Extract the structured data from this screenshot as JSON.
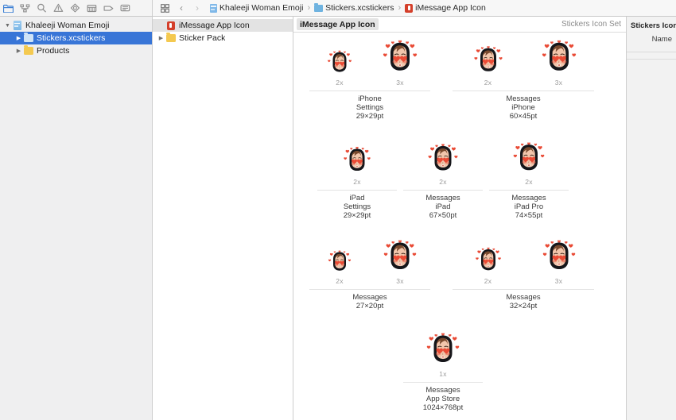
{
  "window": {
    "title": "Xcode"
  },
  "toolbar": {
    "left_icons": [
      {
        "name": "navigator-folder-icon",
        "glyph": "folder",
        "active": true
      },
      {
        "name": "source-control-icon",
        "glyph": "branch",
        "active": false
      },
      {
        "name": "search-icon",
        "glyph": "magnifier",
        "active": false
      },
      {
        "name": "issue-navigator-icon",
        "glyph": "warning-triangle",
        "active": false
      },
      {
        "name": "test-navigator-icon",
        "glyph": "diamond",
        "active": false
      },
      {
        "name": "debug-navigator-icon",
        "glyph": "gauge",
        "active": false
      },
      {
        "name": "breakpoint-navigator-icon",
        "glyph": "tag",
        "active": false
      },
      {
        "name": "report-navigator-icon",
        "glyph": "speech-bubble",
        "active": false
      }
    ],
    "grid_button": "grid-view-icon",
    "back_arrow": "‹",
    "forward_arrow": "›"
  },
  "breadcrumbs": {
    "separator": "›",
    "items": [
      {
        "label": "Khaleeji Woman Emoji",
        "icon": "project-icon"
      },
      {
        "label": "Stickers.xcstickers",
        "icon": "sticker-catalog-icon"
      },
      {
        "label": "iMessage App Icon",
        "icon": "app-icon-badge"
      }
    ]
  },
  "navigator": {
    "rows": [
      {
        "label": "Khaleeji Woman Emoji",
        "indent": 0,
        "twisty": "open",
        "icon": "project-icon",
        "selected": false
      },
      {
        "label": "Stickers.xcstickers",
        "indent": 1,
        "twisty": "none",
        "icon": "sticker-catalog-icon",
        "selected": true
      },
      {
        "label": "Products",
        "indent": 1,
        "twisty": "closed",
        "icon": "folder-icon",
        "selected": false
      }
    ]
  },
  "asset_list": {
    "rows": [
      {
        "label": "iMessage App Icon",
        "twisty": "none",
        "icon": "app-icon-badge",
        "selected": true
      },
      {
        "label": "Sticker Pack",
        "twisty": "closed",
        "icon": "folder-icon",
        "selected": false
      }
    ]
  },
  "editor": {
    "title": "iMessage App Icon",
    "subtitle": "Stickers Icon Set"
  },
  "inspector": {
    "title": "Stickers Icon",
    "name_label": "Name"
  },
  "icon_set": {
    "groups": [
      {
        "id": "iphone-settings",
        "caption": [
          "iPhone",
          "Settings",
          "29×29pt"
        ],
        "slots": [
          {
            "scale": "2x",
            "size": 34
          },
          {
            "scale": "3x",
            "size": 48
          }
        ]
      },
      {
        "id": "messages-iphone",
        "caption": [
          "Messages",
          "iPhone",
          "60×45pt"
        ],
        "slots": [
          {
            "scale": "2x",
            "size": 40
          },
          {
            "scale": "3x",
            "size": 48
          }
        ]
      },
      {
        "id": "ipad-settings",
        "caption": [
          "iPad",
          "Settings",
          "29×29pt"
        ],
        "slots": [
          {
            "scale": "2x",
            "size": 38
          }
        ]
      },
      {
        "id": "messages-ipad",
        "caption": [
          "Messages",
          "iPad",
          "67×50pt"
        ],
        "slots": [
          {
            "scale": "2x",
            "size": 42
          }
        ]
      },
      {
        "id": "messages-ipad-pro",
        "caption": [
          "Messages",
          "iPad Pro",
          "74×55pt"
        ],
        "slots": [
          {
            "scale": "2x",
            "size": 44
          }
        ]
      },
      {
        "id": "messages-27x20",
        "caption": [
          "Messages",
          "27×20pt"
        ],
        "slots": [
          {
            "scale": "2x",
            "size": 32
          },
          {
            "scale": "3x",
            "size": 46
          }
        ]
      },
      {
        "id": "messages-32x24",
        "caption": [
          "Messages",
          "32×24pt"
        ],
        "slots": [
          {
            "scale": "2x",
            "size": 36
          },
          {
            "scale": "3x",
            "size": 46
          }
        ]
      },
      {
        "id": "messages-app-store",
        "caption": [
          "Messages",
          "App Store",
          "1024×768pt"
        ],
        "slots": [
          {
            "scale": "1x",
            "size": 46
          }
        ]
      }
    ]
  },
  "colors": {
    "selection_blue": "#3875d7",
    "window_chrome": "#f2f2f2",
    "navigator_bg": "#efeff0",
    "editor_bg": "#ffffff",
    "hijab_black": "#16161a",
    "skin": "#f2c6ac",
    "hair_brown": "#7a4a2e",
    "heart_red": "#e8402a",
    "blush_red": "#e64a33"
  }
}
